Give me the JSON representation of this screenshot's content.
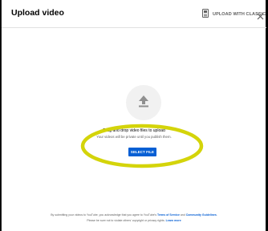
{
  "dialog": {
    "title": "Upload video",
    "classic_label": "UPLOAD WITH CLASSIC",
    "close_icon": "close-icon",
    "classic_icon": "classic-studio-icon"
  },
  "main": {
    "upload_icon": "upload-arrow-icon",
    "drag_text_start": "Drag and drop video files to ",
    "drag_text_end": "upload",
    "private_text": "Your videos will be private until you publish them.",
    "select_button": "SELECT FILE"
  },
  "footer": {
    "line1_start": "By submitting your videos to YouTube, you acknowledge that you agree to YouTube's ",
    "terms_link": "Terms of Service",
    "and_text": " and ",
    "guidelines_link": "Community Guidelines",
    "line1_end": ".",
    "line2_start": "Please be sure not to violate others' copyright or privacy rights. ",
    "learn_more": "Learn more"
  },
  "colors": {
    "accent": "#065fd4",
    "highlight": "#d4d40a",
    "circle_bg": "#f1f1f1",
    "icon_gray": "#909090"
  }
}
